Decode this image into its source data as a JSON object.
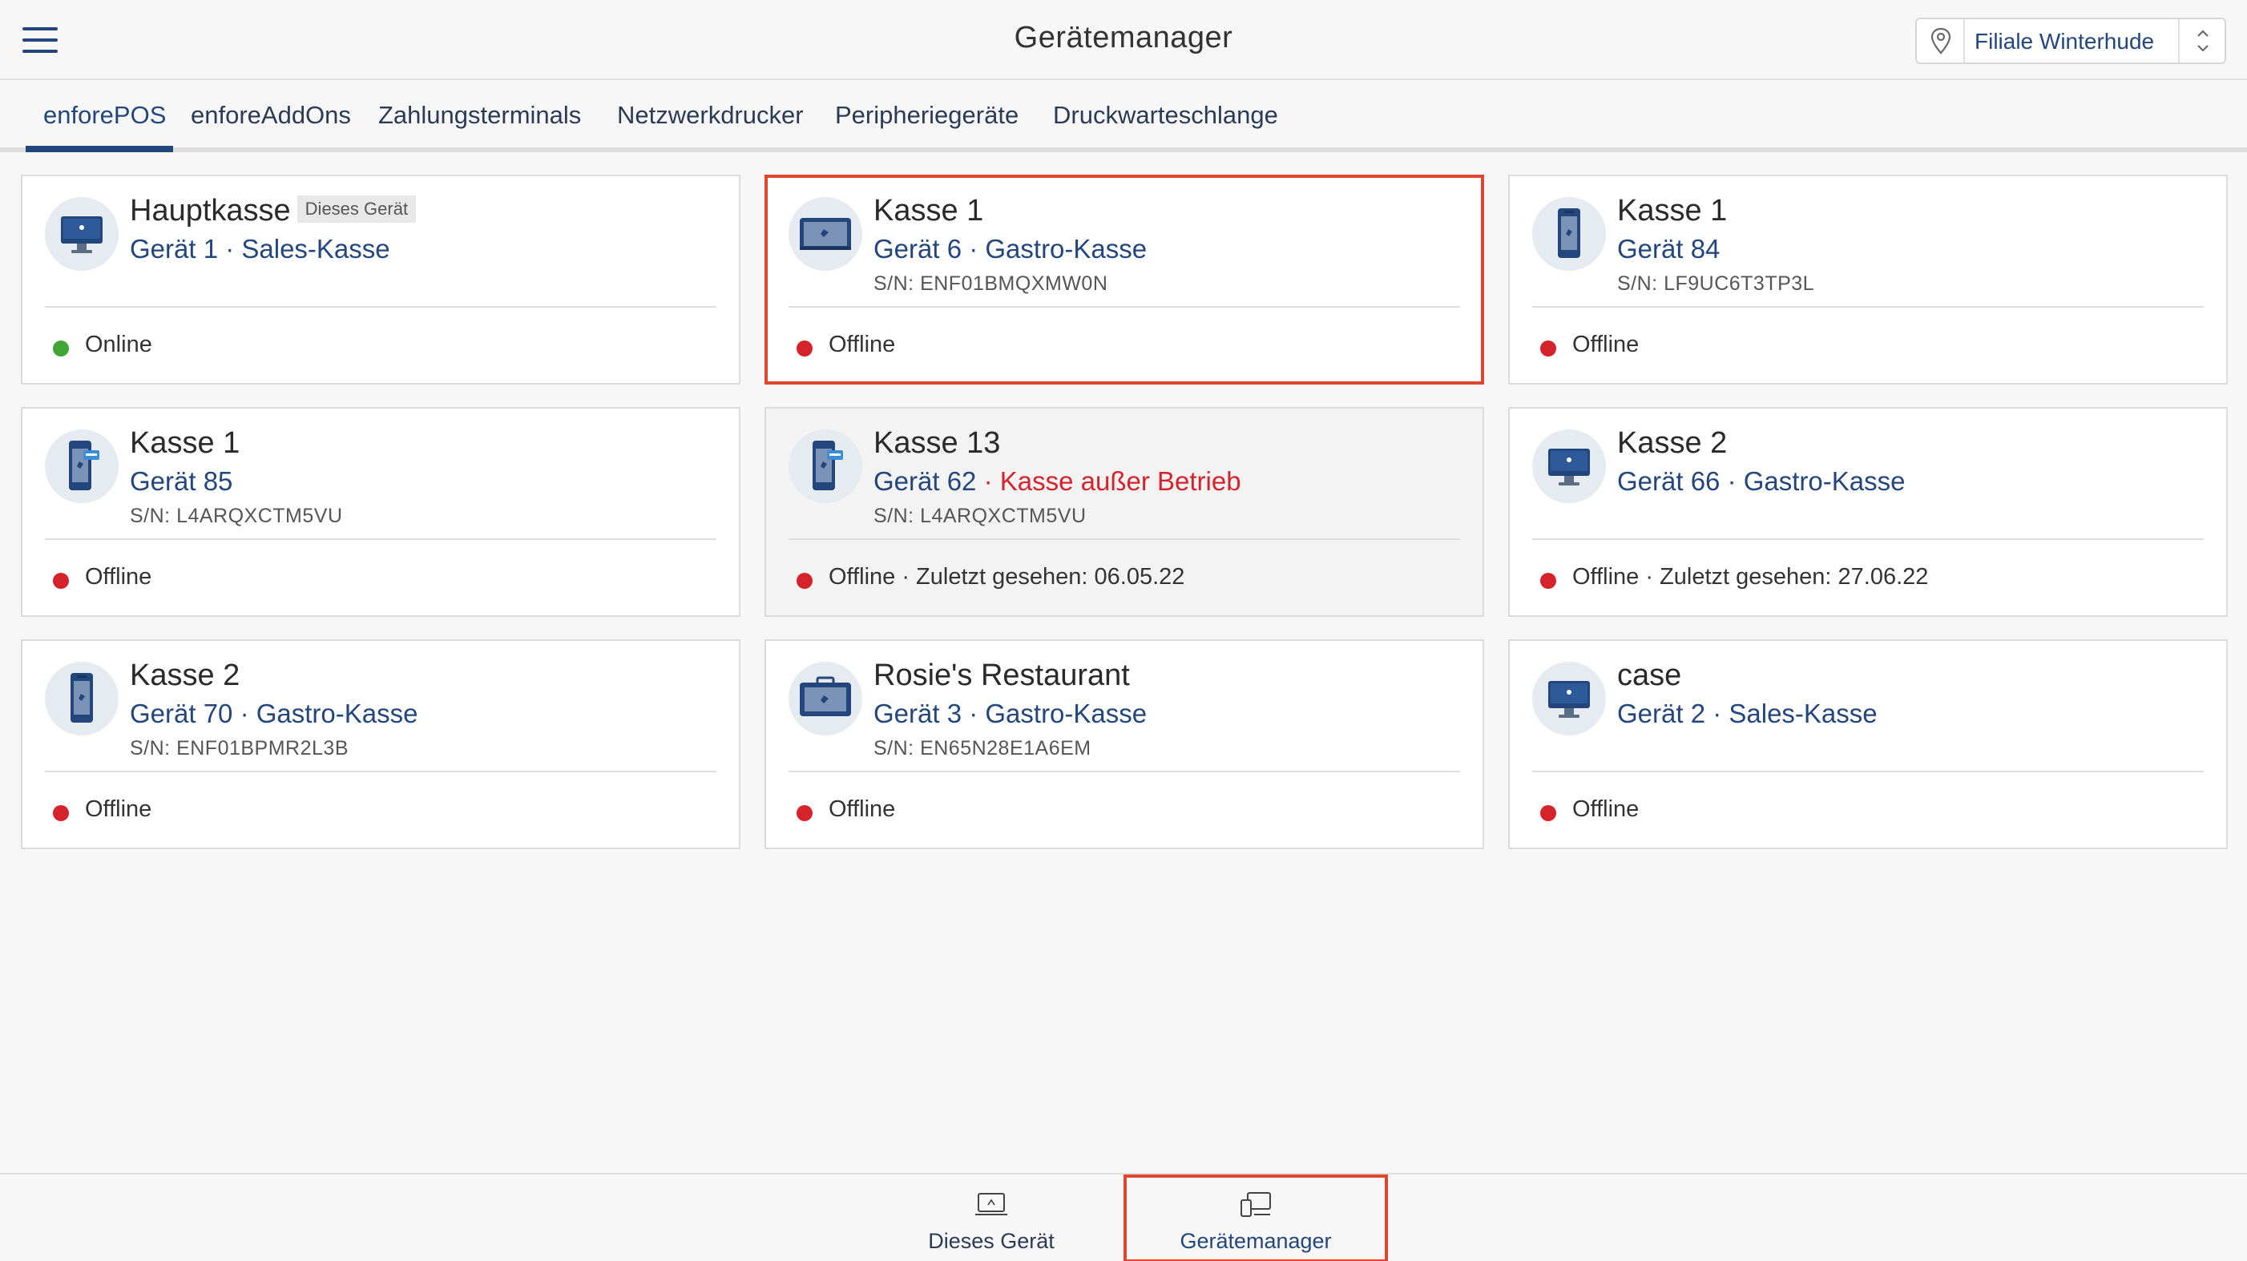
{
  "header": {
    "title": "Gerätemanager",
    "store": "Filiale Winterhude"
  },
  "tabs": [
    {
      "label": "enforePOS",
      "active": true
    },
    {
      "label": "enforeAddOns"
    },
    {
      "label": "Zahlungsterminals"
    },
    {
      "label": "Netzwerkdrucker"
    },
    {
      "label": "Peripheriegeräte"
    },
    {
      "label": "Druckwarteschlange"
    }
  ],
  "devices": [
    {
      "name": "Hauptkasse",
      "badge": "Dieses Gerät",
      "sub": "Gerät 1 · Sales-Kasse",
      "serial": "",
      "status": "Online",
      "status_color": "#3fa535",
      "icon": "desktop-pos-icon"
    },
    {
      "name": "Kasse 1",
      "sub": "Gerät 6 · Gastro-Kasse",
      "serial": "S/N: ENF01BMQXMW0N",
      "status": "Offline",
      "status_color": "#d5232c",
      "icon": "tablet-pos-icon",
      "highlight": true
    },
    {
      "name": "Kasse 1",
      "sub": "Gerät 84",
      "serial": "S/N: LF9UC6T3TP3L",
      "status": "Offline",
      "status_color": "#d5232c",
      "icon": "handheld-pos-icon"
    },
    {
      "name": "Kasse 1",
      "sub": "Gerät 85",
      "serial": "S/N: L4ARQXCTM5VU",
      "status": "Offline",
      "status_color": "#d5232c",
      "icon": "handheld-pay-icon"
    },
    {
      "name": "Kasse 13",
      "sub": "Gerät 62",
      "sub_warn": " · Kasse außer Betrieb",
      "serial": "S/N: L4ARQXCTM5VU",
      "status": "Offline · Zuletzt gesehen: 06.05.22",
      "status_color": "#d5232c",
      "icon": "handheld-pay-icon",
      "disabled": true
    },
    {
      "name": "Kasse 2",
      "sub": "Gerät 66 · Gastro-Kasse",
      "serial": "",
      "status": "Offline · Zuletzt gesehen: 27.06.22",
      "status_color": "#d5232c",
      "icon": "desktop-pos-icon"
    },
    {
      "name": "Kasse 2",
      "sub": "Gerät 70 · Gastro-Kasse",
      "serial": "S/N: ENF01BPMR2L3B",
      "status": "Offline",
      "status_color": "#d5232c",
      "icon": "handheld-pos-icon"
    },
    {
      "name": "Rosie's Restaurant",
      "sub": "Gerät 3 · Gastro-Kasse",
      "serial": "S/N: EN65N28E1A6EM",
      "status": "Offline",
      "status_color": "#d5232c",
      "icon": "tablet-case-icon"
    },
    {
      "name": "case",
      "sub": "Gerät 2 · Sales-Kasse",
      "serial": "",
      "status": "Offline",
      "status_color": "#d5232c",
      "icon": "desktop-pos-icon"
    }
  ],
  "bottom_nav": [
    {
      "label": "Dieses Gerät",
      "icon": "this-device-icon"
    },
    {
      "label": "Gerätemanager",
      "icon": "device-manager-icon",
      "active": true
    }
  ],
  "colors": {
    "brand": "#23467d",
    "online": "#3fa535",
    "offline": "#d5232c",
    "highlight": "#e0462e"
  }
}
